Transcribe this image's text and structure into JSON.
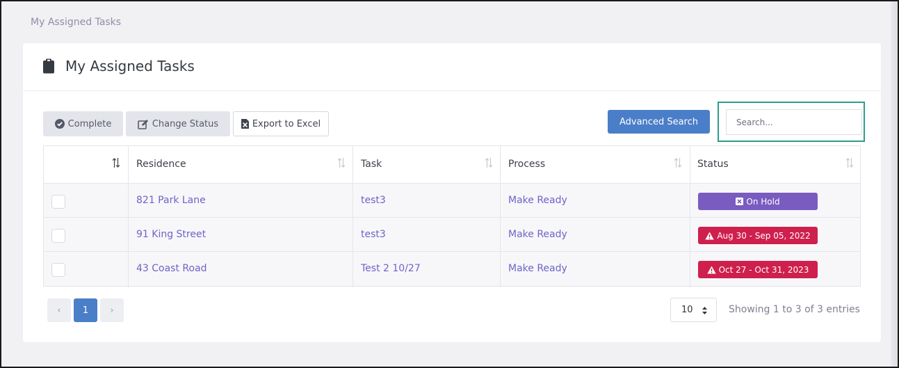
{
  "breadcrumb": "My Assigned Tasks",
  "page_title": "My Assigned Tasks",
  "toolbar": {
    "complete_label": "Complete",
    "change_status_label": "Change Status",
    "export_label": "Export to Excel",
    "advanced_search_label": "Advanced Search",
    "search_placeholder": "Search..."
  },
  "table": {
    "columns": [
      "",
      "Residence",
      "Task",
      "Process",
      "Status"
    ],
    "rows": [
      {
        "residence": "821 Park Lane",
        "task": "test3",
        "process": "Make Ready",
        "status": "On Hold",
        "status_kind": "on-hold"
      },
      {
        "residence": "91 King Street",
        "task": "test3",
        "process": "Make Ready",
        "status": "Aug 30 - Sep 05, 2022",
        "status_kind": "due"
      },
      {
        "residence": "43 Coast Road",
        "task": "Test 2 10/27",
        "process": "Make Ready",
        "status": "Oct 27 - Oct 31, 2023",
        "status_kind": "due"
      }
    ]
  },
  "pagination": {
    "prev": "‹",
    "current_page": "1",
    "next": "›",
    "page_size": "10",
    "info": "Showing 1 to 3 of 3 entries"
  },
  "colors": {
    "accent": "#4a7ec8",
    "link": "#6e63c9",
    "on_hold": "#7a5bbf",
    "due": "#cf1f4d",
    "search_highlight": "#2c9d8a"
  }
}
